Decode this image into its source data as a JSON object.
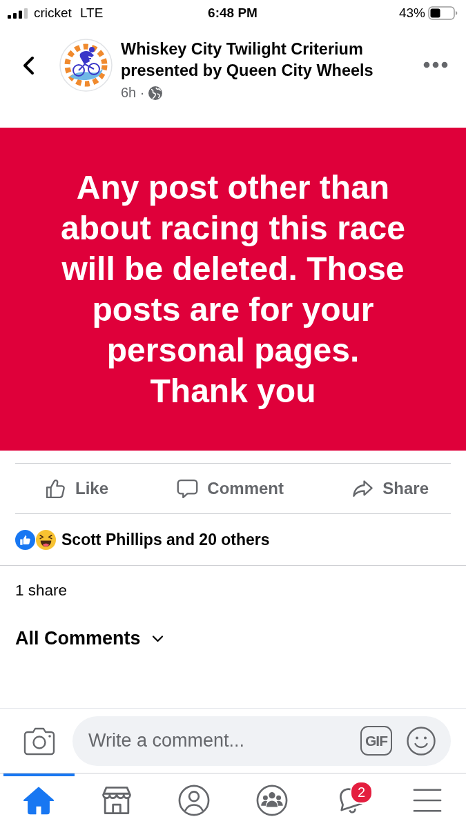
{
  "status_bar": {
    "carrier": "cricket",
    "network": "LTE",
    "time": "6:48 PM",
    "battery": "43%"
  },
  "post_header": {
    "page_name": "Whiskey City Twilight Criterium presented by Queen City Wheels",
    "age": "6h ·"
  },
  "post": {
    "message": "Any post other than about racing this race will be deleted. Those posts are for your personal pages.\nThank you"
  },
  "actions": [
    {
      "kind": "like",
      "label": "Like"
    },
    {
      "kind": "comment",
      "label": "Comment"
    },
    {
      "kind": "share",
      "label": "Share"
    }
  ],
  "reactions": {
    "summary": "Scott Phillips and 20 others"
  },
  "shares": "1 share",
  "comments": {
    "sort": "All Comments"
  },
  "composer": {
    "placeholder": "Write a comment...",
    "gif_label": "GIF"
  },
  "tabs": [
    {
      "kind": "home",
      "selected": true
    },
    {
      "kind": "marketplace",
      "selected": false
    },
    {
      "kind": "profile",
      "selected": false
    },
    {
      "kind": "groups",
      "selected": false
    },
    {
      "kind": "notifications",
      "selected": false,
      "badge": "2"
    },
    {
      "kind": "menu",
      "selected": false
    }
  ]
}
